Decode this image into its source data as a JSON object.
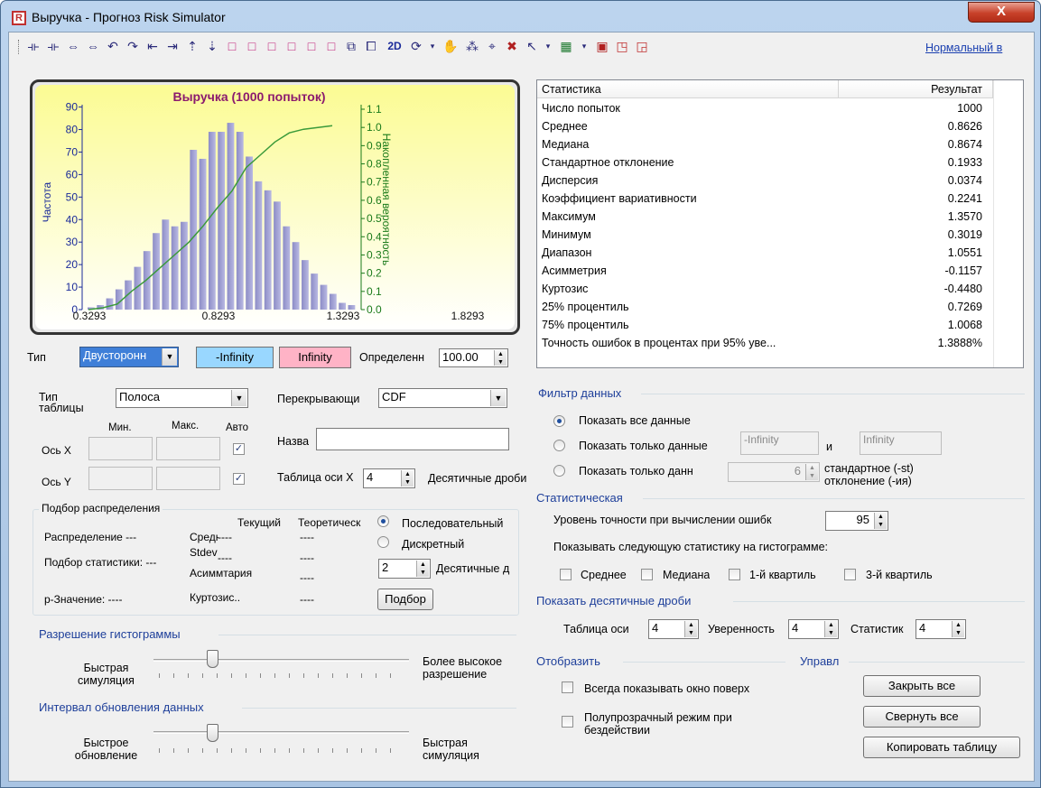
{
  "window": {
    "title": "Выручка - Прогноз Risk Simulator",
    "close": "X"
  },
  "toolbar": {
    "mode_label": "2D",
    "link": "Нормальный в"
  },
  "chart_data": {
    "type": "bar",
    "title": "Выручка (1000 попыток)",
    "ylabel": "Частота",
    "y2label": "Накопленная вероятность",
    "xticks": [
      "0.3293",
      "0.8293",
      "1.3293",
      "1.8293"
    ],
    "yticks": [
      "0",
      "10",
      "20",
      "30",
      "40",
      "50",
      "60",
      "70",
      "80",
      "90"
    ],
    "y2ticks": [
      "0.0",
      "0.1",
      "0.2",
      "0.3",
      "0.4",
      "0.5",
      "0.6",
      "0.7",
      "0.8",
      "0.9",
      "1.0",
      "1.1"
    ],
    "ylim": [
      0,
      90
    ],
    "y2lim": [
      0,
      1.1
    ],
    "bars": [
      1,
      2,
      5,
      9,
      13,
      19,
      26,
      34,
      40,
      37,
      39,
      71,
      67,
      79,
      79,
      83,
      79,
      68,
      57,
      53,
      48,
      37,
      30,
      22,
      16,
      11,
      7,
      3,
      2
    ],
    "cdf": [
      0,
      0.01,
      0.03,
      0.1,
      0.16,
      0.23,
      0.3,
      0.37,
      0.46,
      0.56,
      0.65,
      0.78,
      0.85,
      0.92,
      0.97,
      0.99,
      1.0,
      1.01
    ]
  },
  "chart_controls": {
    "type_label": "Тип",
    "type_value": "Двусторонн",
    "left_value": "-Infinity",
    "right_value": "Infinity",
    "certainty_label": "Определенн",
    "certainty_value": "100.00"
  },
  "chart_props": {
    "table_type_label": "Тип таблицы",
    "table_type_value": "Полоса",
    "overlay_label": "Перекрывающи",
    "overlay_value": "CDF",
    "min_label": "Мин.",
    "max_label": "Макс.",
    "auto_label": "Авто",
    "axis_x_label": "Ось X",
    "axis_y_label": "Ось Y",
    "name_label": "Назва",
    "x_axis_table_label": "Таблица оси X",
    "x_axis_table_value": "4",
    "decimals_label": "Десятичные дроби"
  },
  "fitting": {
    "title": "Подбор распределения",
    "current": "Текущий",
    "theoretical": "Теоретическ",
    "distribution": "Распределение ---",
    "mean": "Средне",
    "mean_cur": "----",
    "mean_theo": "----",
    "stdev": "Stdev",
    "stdev_cur": "----",
    "stdev_theo": "----",
    "fit_stat": "Подбор статистики: ---",
    "skew": "Асиммтария",
    "skew_theo": "----",
    "pvalue": "p-Значение: ----",
    "kurt": "Куртозис..",
    "kurt_theo": "----",
    "continuous": "Последовательный",
    "discrete": "Дискретный",
    "decimals_value": "2",
    "decimals_label": "Десятичные д",
    "fit_button": "Подбор"
  },
  "resolution": {
    "title": "Разрешение гистограммы",
    "left": "Быстрая симуляция",
    "right": "Более высокое разрешение",
    "level": 0.33
  },
  "refresh": {
    "title": "Интервал обновления данных",
    "left": "Быстрое обновление",
    "right": "Быстрая симуляция",
    "level": 0.33
  },
  "stats": {
    "col1": "Статистика",
    "col2": "Результат",
    "rows": [
      {
        "k": "Число попыток",
        "v": "1000"
      },
      {
        "k": "Среднее",
        "v": "0.8626"
      },
      {
        "k": "Медиана",
        "v": "0.8674"
      },
      {
        "k": "Стандартное отклонение",
        "v": "0.1933"
      },
      {
        "k": "Дисперсия",
        "v": "0.0374"
      },
      {
        "k": "Коэффициент вариативности",
        "v": "0.2241"
      },
      {
        "k": "Максимум",
        "v": "1.3570"
      },
      {
        "k": "Минимум",
        "v": "0.3019"
      },
      {
        "k": "Диапазон",
        "v": "1.0551"
      },
      {
        "k": "Асимметрия",
        "v": "-0.1157"
      },
      {
        "k": "Куртозис",
        "v": "-0.4480"
      },
      {
        "k": "25% процентиль",
        "v": "0.7269"
      },
      {
        "k": "75% процентиль",
        "v": "1.0068"
      },
      {
        "k": "Точность ошибок в процентах при 95% уве...",
        "v": "1.3888%"
      }
    ]
  },
  "filter": {
    "title": "Фильтр данных",
    "all": "Показать все данные",
    "only": "Показать только данные",
    "only_from": "-Infinity",
    "and": "и",
    "only_to": "Infinity",
    "only_sd": "Показать только данн",
    "sd_value": "6",
    "sd_label": "стандартное (-st) отклонение (-ия)"
  },
  "statistical": {
    "title": "Статистическая",
    "precision_label": "Уровень точности при вычислении ошибк",
    "precision_value": "95",
    "show_label": "Показывать следующую статистику на гистограмме:",
    "mean": "Среднее",
    "median": "Медиана",
    "q1": "1-й квартиль",
    "q3": "3-й квартиль"
  },
  "decimals": {
    "title": "Показать десятичные дроби",
    "table_label": "Таблица оси",
    "table_value": "4",
    "conf_label": "Уверенность",
    "conf_value": "4",
    "stat_label": "Статистик",
    "stat_value": "4"
  },
  "display": {
    "title": "Отобразить",
    "ontop": "Всегда показывать окно поверх",
    "translucent": "Полупрозрачный режим при бездействии"
  },
  "control": {
    "title": "Управл",
    "close_all": "Закрыть все",
    "minimize_all": "Свернуть все",
    "copy_table": "Копировать таблицу"
  }
}
